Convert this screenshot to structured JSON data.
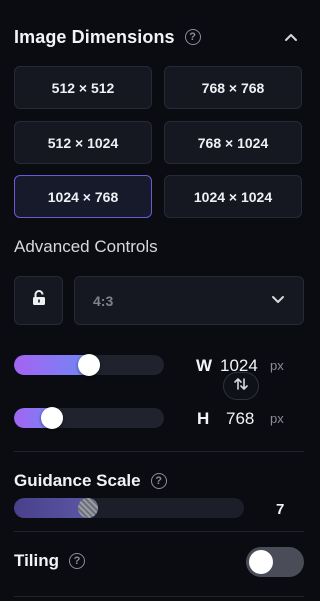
{
  "image_dimensions": {
    "title": "Image Dimensions",
    "help_glyph": "?",
    "presets": [
      {
        "label": "512 × 512",
        "active": false
      },
      {
        "label": "768 × 768",
        "active": false
      },
      {
        "label": "512 × 1024",
        "active": false
      },
      {
        "label": "768 × 1024",
        "active": false
      },
      {
        "label": "1024 × 768",
        "active": true
      },
      {
        "label": "1024 × 1024",
        "active": false
      }
    ],
    "active_color": "#6b5ad6"
  },
  "advanced": {
    "label": "Advanced Controls",
    "aspect_ratio": "4:3",
    "width": {
      "letter": "W",
      "value": "1024",
      "unit": "px",
      "slider_fraction": 0.5
    },
    "height": {
      "letter": "H",
      "value": "768",
      "unit": "px",
      "slider_fraction": 0.25
    },
    "slider_gradient": [
      "#a463f2",
      "#6a8cf5"
    ]
  },
  "guidance": {
    "title": "Guidance Scale",
    "help_glyph": "?",
    "value": "7",
    "slider_fraction": 0.32
  },
  "tiling": {
    "title": "Tiling",
    "help_glyph": "?",
    "enabled": false
  },
  "icons": [
    "help-icon",
    "chevron-up-icon",
    "lock-icon",
    "chevron-down-icon",
    "swap-icon"
  ]
}
